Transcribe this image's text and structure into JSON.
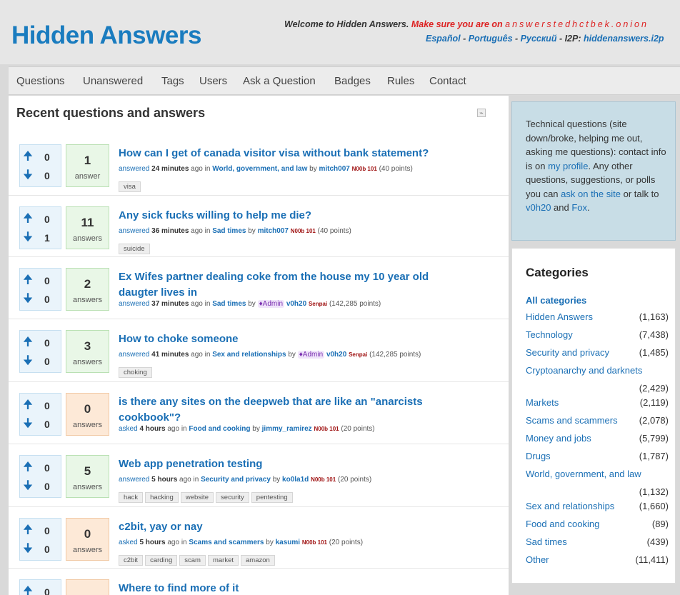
{
  "site": {
    "logo": "Hidden Answers",
    "welcome_prefix": "Welcome to Hidden Answers.",
    "welcome_warning": "Make sure you are on",
    "onion": "answerstedhctbek.onion",
    "lang_es": "Español",
    "lang_pt": "Português",
    "lang_ru": "Русский",
    "i2p_prefix": "I2P:",
    "i2p_link": "hiddenanswers.i2p"
  },
  "nav": [
    "Questions",
    "Unanswered",
    "Tags",
    "Users",
    "Ask a Question",
    "Badges",
    "Rules",
    "Contact"
  ],
  "main": {
    "title": "Recent questions and answers",
    "rss_icon": "rss-icon"
  },
  "questions": [
    {
      "up": "0",
      "down": "0",
      "answers": "1",
      "answers_label": "answer",
      "ans_color": "green",
      "title": "How can I get of canada visitor visa without bank statement?",
      "action": "answered",
      "time": "24 minutes",
      "ago_in": "ago in",
      "category": "World, government, and law",
      "by": "by",
      "user": "mitch007",
      "level": "N00b 101",
      "points": "(40 points)",
      "admin": "",
      "tags": [
        "visa"
      ]
    },
    {
      "up": "0",
      "down": "1",
      "answers": "11",
      "answers_label": "answers",
      "ans_color": "green",
      "title": "Any sick fucks willing to help me die?",
      "action": "answered",
      "time": "36 minutes",
      "ago_in": "ago in",
      "category": "Sad times",
      "by": "by",
      "user": "mitch007",
      "level": "N00b 101",
      "points": "(40 points)",
      "admin": "",
      "tags": [
        "suicide"
      ]
    },
    {
      "up": "0",
      "down": "0",
      "answers": "2",
      "answers_label": "answers",
      "ans_color": "green",
      "title": "Ex Wifes partner dealing coke from the house my 10 year old daugter lives in",
      "action": "answered",
      "time": "37 minutes",
      "ago_in": "ago in",
      "category": "Sad times",
      "by": "by",
      "user": "v0h20",
      "level": "Senpai",
      "points": "(142,285 points)",
      "admin": "♦Admin",
      "tags": []
    },
    {
      "up": "0",
      "down": "0",
      "answers": "3",
      "answers_label": "answers",
      "ans_color": "green",
      "title": "How to choke someone",
      "action": "answered",
      "time": "41 minutes",
      "ago_in": "ago in",
      "category": "Sex and relationships",
      "by": "by",
      "user": "v0h20",
      "level": "Senpai",
      "points": "(142,285 points)",
      "admin": "♦Admin",
      "tags": [
        "choking"
      ]
    },
    {
      "up": "0",
      "down": "0",
      "answers": "0",
      "answers_label": "answers",
      "ans_color": "orange",
      "title": "is there any sites on the deepweb that are like an \"anarcists cookbook\"?",
      "action": "asked",
      "time": "4 hours",
      "ago_in": "ago in",
      "category": "Food and cooking",
      "by": "by",
      "user": "jimmy_ramirez",
      "level": "N00b 101",
      "points": "(20 points)",
      "admin": "",
      "tags": []
    },
    {
      "up": "0",
      "down": "0",
      "answers": "5",
      "answers_label": "answers",
      "ans_color": "green",
      "title": "Web app penetration testing",
      "action": "answered",
      "time": "5 hours",
      "ago_in": "ago in",
      "category": "Security and privacy",
      "by": "by",
      "user": "ko0la1d",
      "level": "N00b 101",
      "points": "(20 points)",
      "admin": "",
      "tags": [
        "hack",
        "hacking",
        "website",
        "security",
        "pentesting"
      ]
    },
    {
      "up": "0",
      "down": "0",
      "answers": "0",
      "answers_label": "answers",
      "ans_color": "orange",
      "title": "c2bit, yay or nay",
      "action": "asked",
      "time": "5 hours",
      "ago_in": "ago in",
      "category": "Scams and scammers",
      "by": "by",
      "user": "kasumi",
      "level": "N00b 101",
      "points": "(20 points)",
      "admin": "",
      "tags": [
        "c2bit",
        "carding",
        "scam",
        "market",
        "amazon"
      ]
    },
    {
      "up": "0",
      "down": "",
      "answers": "",
      "answers_label": "",
      "ans_color": "orange",
      "title": "Where to find more of it",
      "action": "",
      "time": "",
      "ago_in": "",
      "category": "",
      "by": "",
      "user": "",
      "level": "",
      "points": "",
      "admin": "",
      "tags": []
    }
  ],
  "sidebar": {
    "text_1": "Technical questions (site down/broke, helping me out, asking me questions): contact info is on ",
    "link_profile": "my profile",
    "text_2": ". Any other questions, suggestions, or polls you can ",
    "link_ask": "ask on the site",
    "text_3": " or talk to ",
    "link_v0h20": "v0h20",
    "text_4": " and ",
    "link_fox": "Fox",
    "text_5": "."
  },
  "categories": {
    "title": "Categories",
    "all": "All categories",
    "items": [
      {
        "name": "Hidden Answers",
        "count": "(1,163)"
      },
      {
        "name": "Technology",
        "count": "(7,438)"
      },
      {
        "name": "Security and privacy",
        "count": "(1,485)"
      },
      {
        "name": "Cryptoanarchy and darknets",
        "count": "(2,429)"
      },
      {
        "name": "Markets",
        "count": "(2,119)"
      },
      {
        "name": "Scams and scammers",
        "count": "(2,078)"
      },
      {
        "name": "Money and jobs",
        "count": "(5,799)"
      },
      {
        "name": "Drugs",
        "count": "(1,787)"
      },
      {
        "name": "World, government, and law",
        "count": "(1,132)"
      },
      {
        "name": "Sex and relationships",
        "count": "(1,660)"
      },
      {
        "name": "Food and cooking",
        "count": "(89)"
      },
      {
        "name": "Sad times",
        "count": "(439)"
      },
      {
        "name": "Other",
        "count": "(11,411)"
      }
    ]
  }
}
